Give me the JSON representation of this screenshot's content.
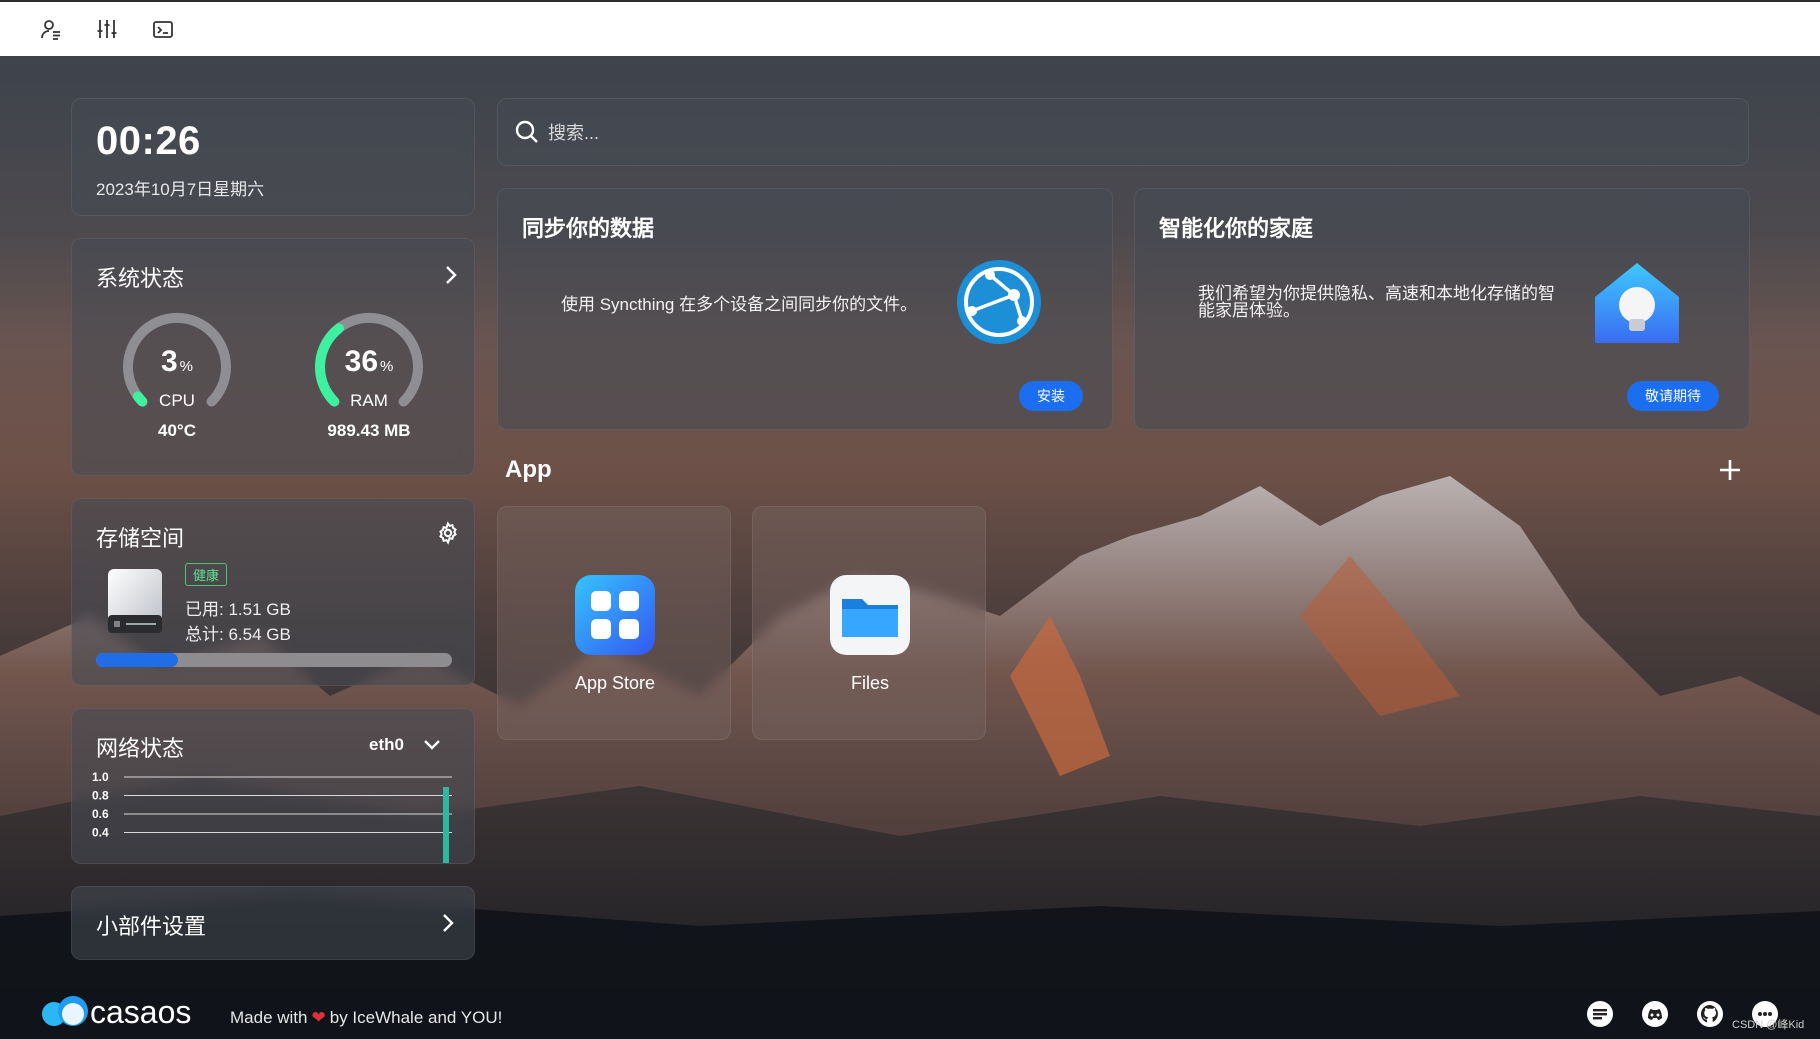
{
  "topbar": {
    "icons": [
      "user-settings-icon",
      "sliders-icon",
      "terminal-icon"
    ]
  },
  "clock": {
    "time": "00:26",
    "date": "2023年10月7日星期六"
  },
  "system_status": {
    "title": "系统状态",
    "cpu": {
      "value": "3",
      "unit": "%",
      "label": "CPU",
      "detail": "40°C",
      "fraction": 0.03
    },
    "ram": {
      "value": "36",
      "unit": "%",
      "label": "RAM",
      "detail": "989.43 MB",
      "fraction": 0.36
    }
  },
  "storage": {
    "title": "存储空间",
    "health": "健康",
    "used": "已用: 1.51 GB",
    "total": "总计: 6.54 GB",
    "used_fraction": 0.231
  },
  "network": {
    "title": "网络状态",
    "interface": "eth0",
    "y_ticks": [
      "1.0",
      "0.8",
      "0.6",
      "0.4"
    ]
  },
  "widget_settings": {
    "title": "小部件设置"
  },
  "search": {
    "placeholder": "搜索..."
  },
  "feature_sync": {
    "title": "同步你的数据",
    "description": "使用 Syncthing 在多个设备之间同步你的文件。",
    "button": "安装"
  },
  "feature_home": {
    "title": "智能化你的家庭",
    "description_line1": "我们希望为你提供隐私、高速和本地化存储的智",
    "description_line2": "能家居体验。",
    "button": "敬请期待"
  },
  "apps": {
    "title": "App",
    "items": [
      {
        "name": "App Store",
        "icon": "app-store-icon"
      },
      {
        "name": "Files",
        "icon": "files-icon"
      }
    ]
  },
  "footer": {
    "logo_text": "casaos",
    "made_prefix": "Made with",
    "made_suffix": "by IceWhale and YOU!",
    "icons": [
      "feedback-icon",
      "discord-icon",
      "github-icon",
      "chat-icon"
    ],
    "watermark": "CSDN @峰Kid"
  },
  "colors": {
    "accent_blue": "#1b6ef0",
    "gauge_green": "#3ef0a0",
    "health_green": "#5fe08e"
  }
}
